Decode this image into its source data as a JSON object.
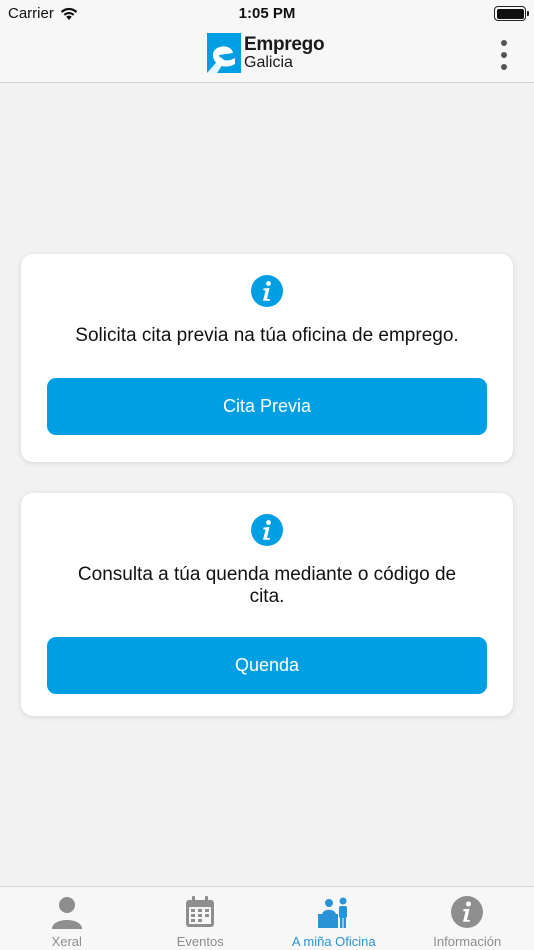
{
  "status_bar": {
    "carrier": "Carrier",
    "time": "1:05 PM"
  },
  "header": {
    "logo_line1": "Emprego",
    "logo_line2": "Galicia"
  },
  "cards": [
    {
      "text": "Solicita cita previa na túa oficina de emprego.",
      "button_label": "Cita Previa"
    },
    {
      "text": "Consulta a túa quenda mediante o código de cita.",
      "button_label": "Quenda"
    }
  ],
  "tab_bar": {
    "tabs": [
      {
        "label": "Xeral",
        "icon": "person-icon",
        "active": false
      },
      {
        "label": "Eventos",
        "icon": "calendar-icon",
        "active": false
      },
      {
        "label": "A miña Oficina",
        "icon": "office-icon",
        "active": true
      },
      {
        "label": "Información",
        "icon": "info-icon",
        "active": false
      }
    ]
  },
  "colors": {
    "accent": "#009fe3",
    "active_tab": "#2a93d5",
    "inactive_tab": "#8e8e8e"
  }
}
